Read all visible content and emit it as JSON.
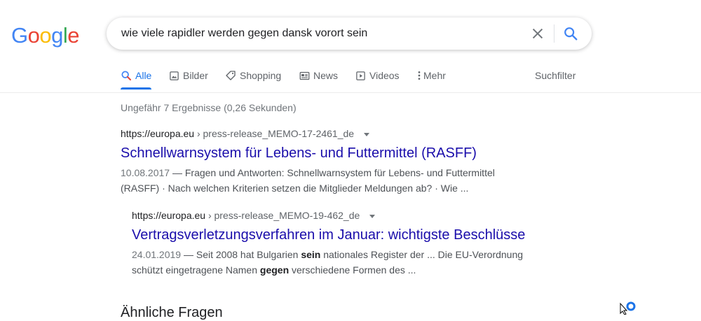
{
  "header": {
    "logo": [
      "G",
      "o",
      "o",
      "g",
      "l",
      "e"
    ],
    "logo_colors": [
      "#4285f4",
      "#ea4335",
      "#fbbc05",
      "#4285f4",
      "#34a853",
      "#ea4335"
    ],
    "query": "wie viele rapidler werden gegen dansk vorort sein"
  },
  "tabs": [
    {
      "label": "Alle",
      "icon": "search-icon",
      "active": true
    },
    {
      "label": "Bilder",
      "icon": "image-icon"
    },
    {
      "label": "Shopping",
      "icon": "tag-icon"
    },
    {
      "label": "News",
      "icon": "news-icon"
    },
    {
      "label": "Videos",
      "icon": "play-icon"
    },
    {
      "label": "Mehr",
      "icon": "more-vert-icon"
    }
  ],
  "tools_label": "Suchfilter",
  "stats": "Ungefähr 7 Ergebnisse (0,26 Sekunden)",
  "results": [
    {
      "domain": "https://europa.eu",
      "path": " › press-release_MEMO-17-2461_de",
      "title": "Schnellwarnsystem für Lebens- und Futtermittel (RASFF)",
      "date": "10.08.2017",
      "snippet": " — Fragen und Antworten: Schnellwarnsystem für Lebens- und Futtermittel (RASFF) · Nach welchen Kriterien setzen die Mitglieder Meldungen ab? · Wie ..."
    },
    {
      "domain": "https://europa.eu",
      "path": " › press-release_MEMO-19-462_de",
      "title": "Vertragsverletzungsverfahren im Januar: wichtigste Beschlüsse",
      "date": "24.01.2019",
      "snippet_parts": [
        " — Seit 2008 hat Bulgarien ",
        "sein",
        " nationales Register der ... Die EU-Verordnung schützt eingetragene Namen ",
        "gegen",
        " verschiedene Formen des ..."
      ]
    }
  ],
  "related_heading": "Ähnliche Fragen",
  "colors": {
    "link": "#1a0dab",
    "accent": "#1a73e8",
    "muted": "#70757a"
  }
}
